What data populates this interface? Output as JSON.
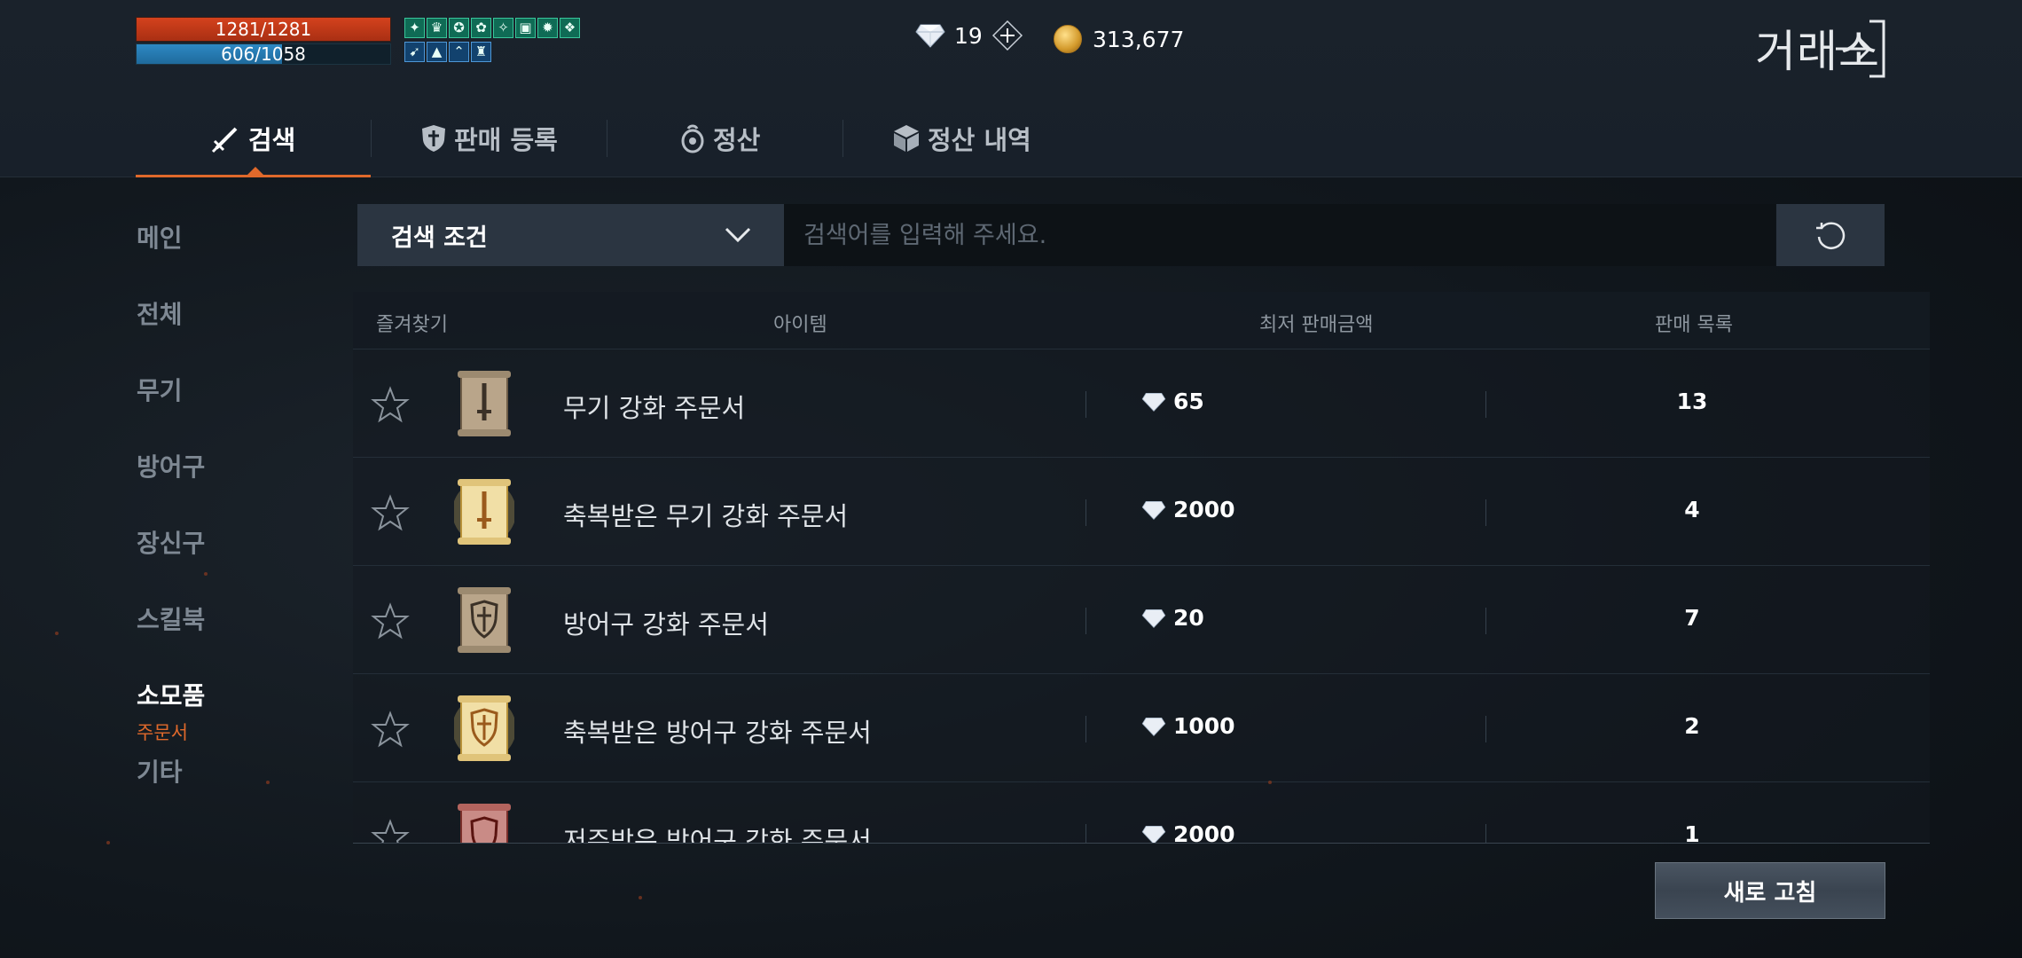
{
  "status": {
    "hp_text": "1281/1281",
    "hp_fraction": 1.0,
    "mp_text": "606/1058",
    "mp_fraction": 0.573,
    "buffs_row1": [
      "buff-icon",
      "buff-icon",
      "buff-icon",
      "buff-icon",
      "buff-icon",
      "buff-icon",
      "buff-icon",
      "buff-icon",
      "buff-icon",
      "buff-icon",
      "buff-icon",
      "buff-icon"
    ],
    "buffs_row2": [
      "buff-icon",
      "buff-icon",
      "buff-icon",
      "buff-icon"
    ]
  },
  "currency": {
    "gems": "19",
    "gold": "313,677"
  },
  "header": {
    "title": "거래소"
  },
  "tabs": [
    {
      "label": "검색",
      "icon": "sword-icon",
      "active": true
    },
    {
      "label": "판매 등록",
      "icon": "shield-icon",
      "active": false
    },
    {
      "label": "정산",
      "icon": "pouch-icon",
      "active": false
    },
    {
      "label": "정산 내역",
      "icon": "box-icon",
      "active": false
    }
  ],
  "sidebar": {
    "items": [
      {
        "label": "메인"
      },
      {
        "label": "전체"
      },
      {
        "label": "무기"
      },
      {
        "label": "방어구"
      },
      {
        "label": "장신구"
      },
      {
        "label": "스킬북"
      },
      {
        "label": "소모품"
      },
      {
        "label": "기타"
      }
    ],
    "active_sub": "주문서"
  },
  "search": {
    "filter_label": "검색 조건",
    "placeholder": "검색어를 입력해 주세요."
  },
  "table": {
    "headers": {
      "favorite": "즐겨찾기",
      "item": "아이템",
      "min_price": "최저 판매금액",
      "listings": "판매 목록"
    },
    "rows": [
      {
        "name": "무기 강화 주문서",
        "price": "65",
        "count": "13",
        "variant": "weapon"
      },
      {
        "name": "축복받은 무기 강화 주문서",
        "price": "2000",
        "count": "4",
        "variant": "weapon-blessed"
      },
      {
        "name": "방어구 강화 주문서",
        "price": "20",
        "count": "7",
        "variant": "armor"
      },
      {
        "name": "축복받은 방어구 강화 주문서",
        "price": "1000",
        "count": "2",
        "variant": "armor-blessed"
      },
      {
        "name": "저주받은 방어구 강화 주문서",
        "price": "2000",
        "count": "1",
        "variant": "armor-cursed"
      }
    ]
  },
  "footer": {
    "refresh_label": "새로 고침"
  },
  "colors": {
    "accent": "#e0692b",
    "hp": "#c63b19",
    "mp": "#2a7db4"
  }
}
